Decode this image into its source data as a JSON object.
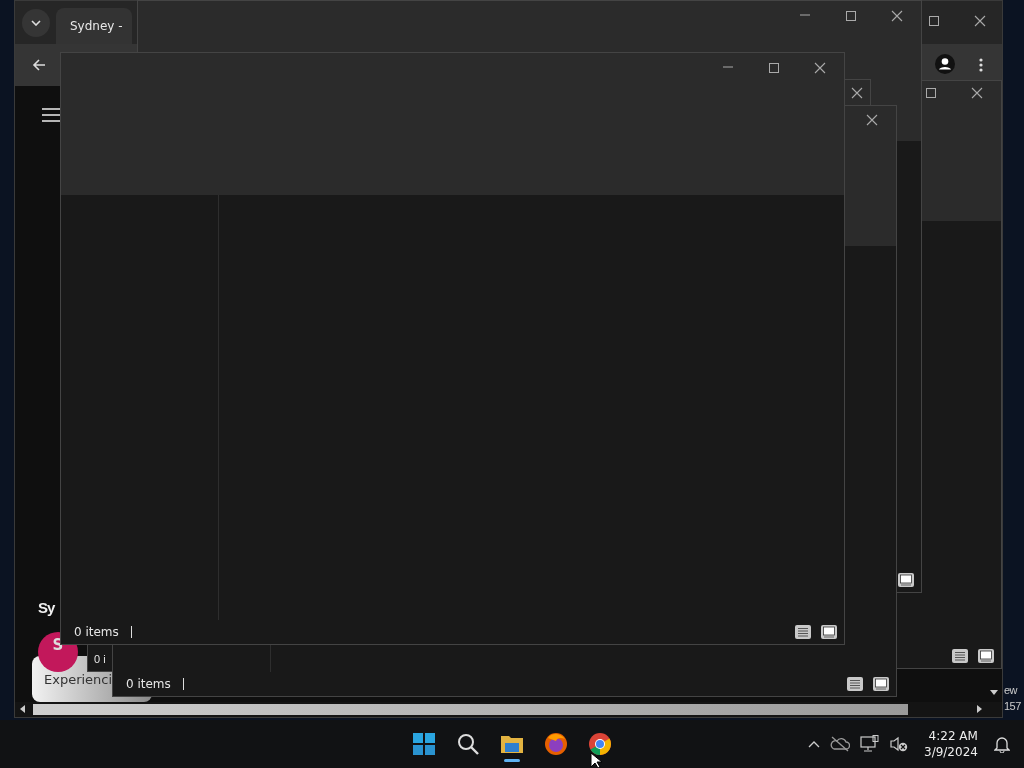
{
  "browser": {
    "tab_title": "Sydney -",
    "channel_heading": "Sy",
    "avatar_letter": "S",
    "chip_label": "Experienci"
  },
  "windows": [
    {
      "kind": "side"
    },
    {
      "kind": "rear"
    },
    {
      "kind": "sliver"
    },
    {
      "kind": "peek",
      "status_text": "0 i"
    },
    {
      "kind": "middle",
      "status_text": "0 items"
    },
    {
      "kind": "front",
      "status_text": "0 items"
    }
  ],
  "desktop_icon_label": [
    "ew",
    "157"
  ],
  "taskbar": {
    "apps": [
      {
        "kind": "start",
        "active": false
      },
      {
        "kind": "search",
        "active": false
      },
      {
        "kind": "files",
        "active": true
      },
      {
        "kind": "firefox",
        "active": false
      },
      {
        "kind": "chrome",
        "active": false
      }
    ],
    "time": "4:22 AM",
    "date": "3/9/2024"
  }
}
